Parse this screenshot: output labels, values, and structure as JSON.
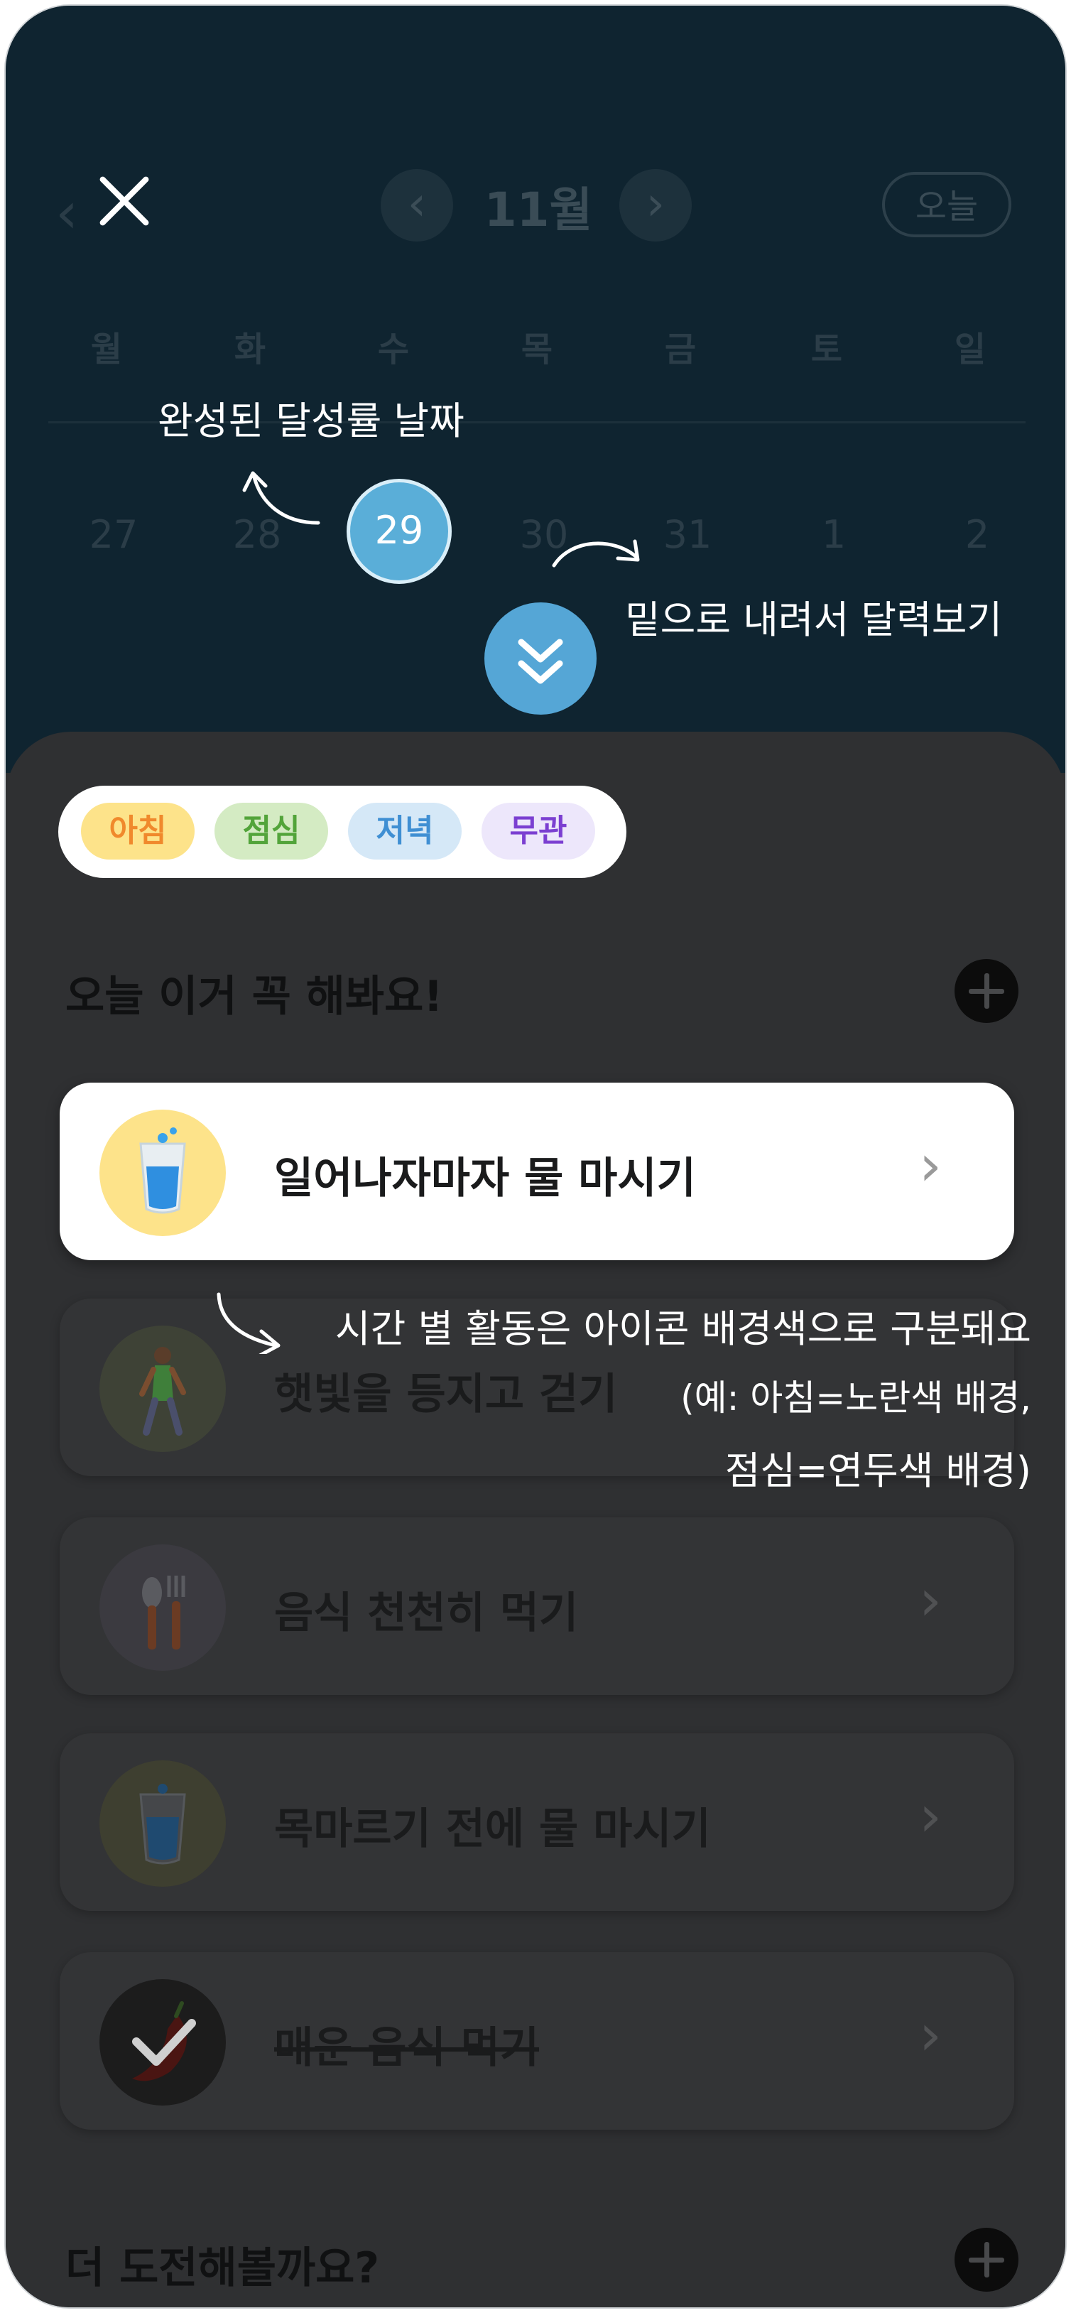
{
  "header": {
    "back_glyph": "‹",
    "month": "11월",
    "prev_glyph": "‹",
    "next_glyph": "›",
    "today_label": "오늘"
  },
  "weekdays": [
    "월",
    "화",
    "수",
    "목",
    "금",
    "토",
    "일"
  ],
  "days": [
    "27",
    "28",
    "29",
    "30",
    "31",
    "1",
    "2"
  ],
  "selected_day": "29",
  "annotations": {
    "completed_date": "완성된 달성률 날짜",
    "scroll_down": "밑으로 내려서 달력보기",
    "time_colors_line1": "시간 별 활동은 아이콘 배경색으로 구분돼요",
    "time_colors_line2": "(예: 아침=노란색 배경,",
    "time_colors_line3": "점심=연두색 배경)"
  },
  "filters": [
    {
      "label": "아침",
      "bg": "#fde38a",
      "fg": "#f0892c"
    },
    {
      "label": "점심",
      "bg": "#d4ebc3",
      "fg": "#52a43a"
    },
    {
      "label": "저녁",
      "bg": "#d5e8f7",
      "fg": "#3f8fd3"
    },
    {
      "label": "무관",
      "bg": "#ede7fb",
      "fg": "#7b3fd1"
    }
  ],
  "sections": {
    "today_title": "오늘 이거 꼭 해봐요!",
    "more_title": "더 도전해볼까요?"
  },
  "tasks": [
    {
      "title": "일어나자마자 물 마시기",
      "icon": "water-glass-icon",
      "icon_bg": "#fde38a",
      "active": true,
      "done": false
    },
    {
      "title": "햇빛을 등지고 걷기",
      "icon": "walking-person-icon",
      "icon_bg": "#3e4236",
      "active": false,
      "done": false
    },
    {
      "title": "음식 천천히 먹기",
      "icon": "utensils-icon",
      "icon_bg": "#3b3a40",
      "active": false,
      "done": false
    },
    {
      "title": "목마르기 전에 물 마시기",
      "icon": "water-glass-icon",
      "icon_bg": "#3e3f30",
      "active": false,
      "done": false
    },
    {
      "title": "매운 음식 먹기",
      "icon": "chili-pepper-icon",
      "icon_bg": "#1c1c1c",
      "active": false,
      "done": true
    }
  ],
  "chevron_glyph": "›"
}
